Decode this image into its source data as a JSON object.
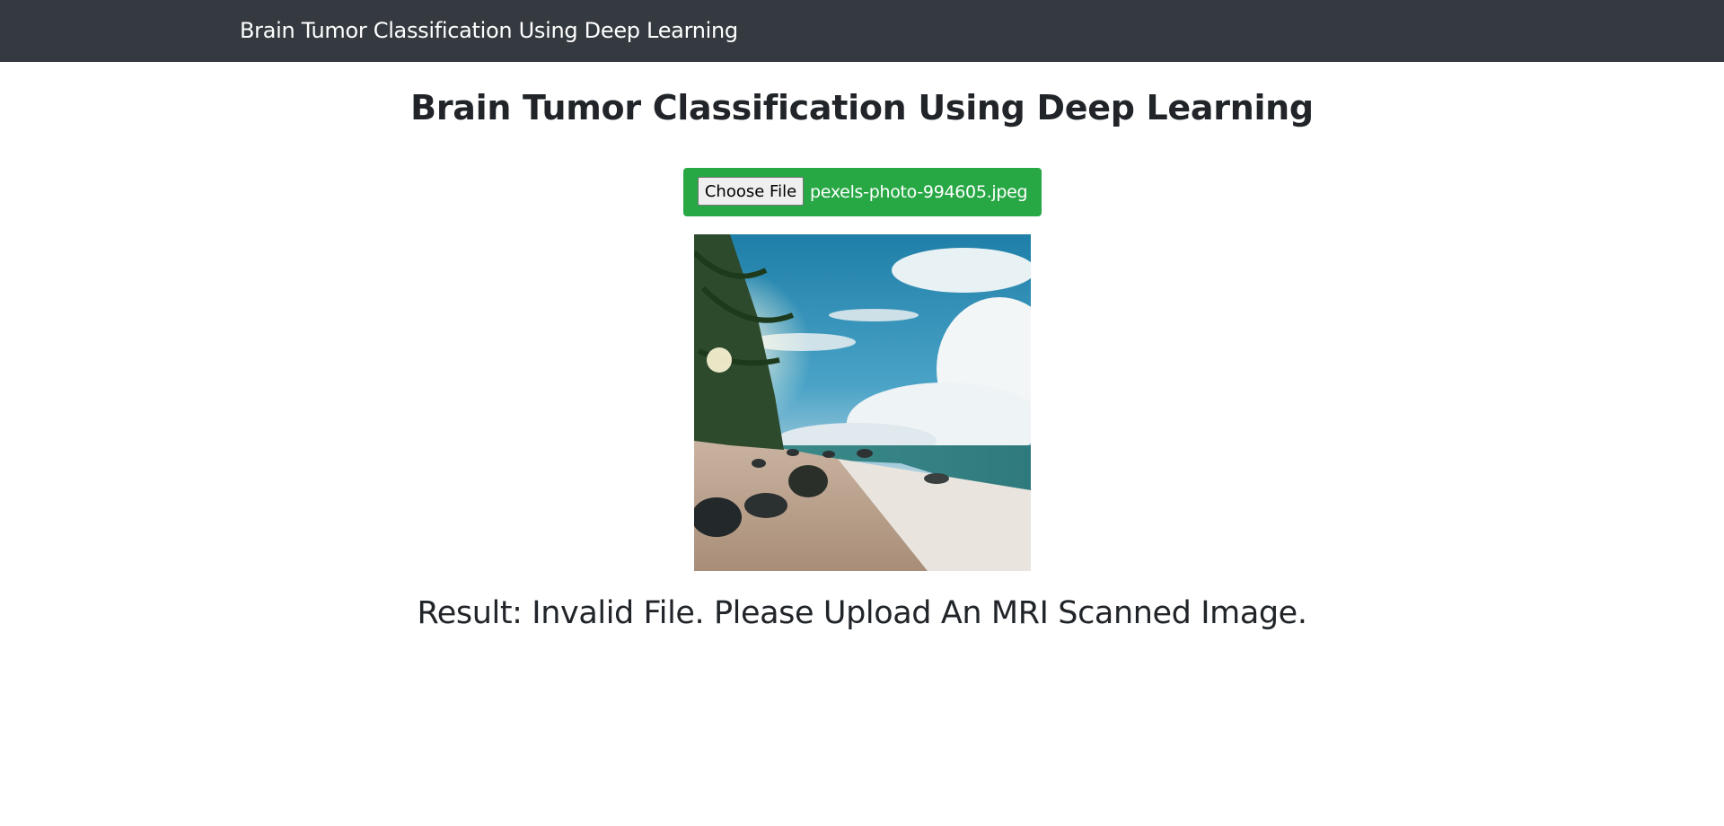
{
  "navbar": {
    "brand": "Brain Tumor Classification Using Deep Learning"
  },
  "main": {
    "title": "Brain Tumor Classification Using Deep Learning",
    "upload": {
      "button_label": "Choose File",
      "file_name": "pexels-photo-994605.jpeg"
    },
    "result_text": "Result: Invalid File. Please Upload An MRI Scanned Image."
  },
  "colors": {
    "navbar_bg": "#343a40",
    "upload_bg": "#28a745",
    "text": "#212529"
  }
}
